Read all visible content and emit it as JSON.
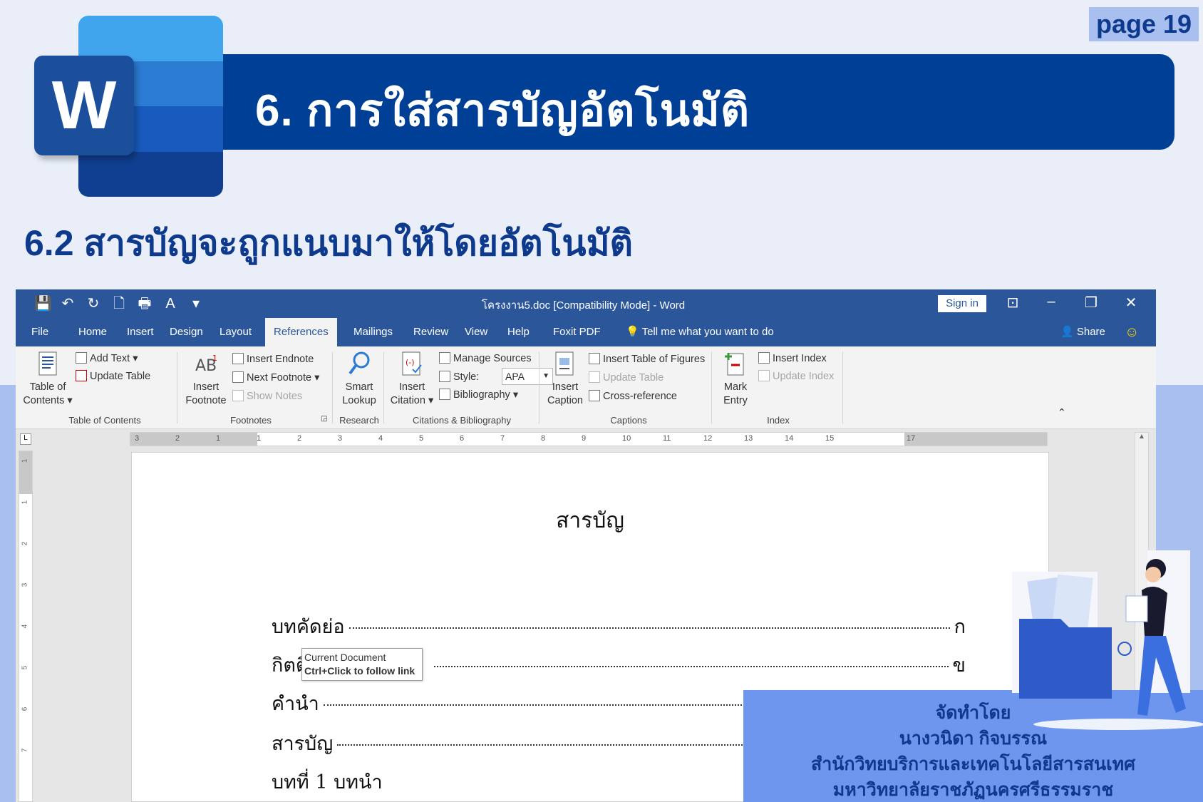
{
  "slide": {
    "page_label": "page 19",
    "title": "6.   การใส่สารบัญอัตโนมัติ",
    "subtitle": "6.2  สารบัญจะถูกแนบมาให้โดยอัตโนมัติ",
    "logo_letter": "W"
  },
  "window": {
    "title": "โครงงาน5.doc [Compatibility Mode]  -  Word",
    "sign_in": "Sign in",
    "share": "Share"
  },
  "tabs": [
    "File",
    "Home",
    "Insert",
    "Design",
    "Layout",
    "References",
    "Mailings",
    "Review",
    "View",
    "Help",
    "Foxit PDF"
  ],
  "active_tab": "References",
  "tell_me": "Tell me what you want to do",
  "ribbon": {
    "toc": {
      "big": [
        "Table of",
        "Contents ▾"
      ],
      "add_text": "Add Text ▾",
      "update_table": "Update Table",
      "label": "Table of Contents"
    },
    "footnotes": {
      "big": [
        "Insert",
        "Footnote"
      ],
      "insert_endnote": "Insert Endnote",
      "next_footnote": "Next Footnote",
      "show_notes": "Show Notes",
      "label": "Footnotes"
    },
    "research": {
      "big": [
        "Smart",
        "Lookup"
      ],
      "label": "Research"
    },
    "citations": {
      "big": [
        "Insert",
        "Citation ▾"
      ],
      "manage_sources": "Manage Sources",
      "style_label": "Style:",
      "style_value": "APA",
      "bibliography": "Bibliography ▾",
      "label": "Citations & Bibliography"
    },
    "captions": {
      "big": [
        "Insert",
        "Caption"
      ],
      "insert_tof": "Insert Table of Figures",
      "update_table": "Update Table",
      "cross_ref": "Cross-reference",
      "label": "Captions"
    },
    "index": {
      "big": [
        "Mark",
        "Entry"
      ],
      "insert_index": "Insert Index",
      "update_index": "Update Index",
      "label": "Index"
    }
  },
  "ruler": {
    "h_labels": [
      "3",
      "2",
      "1",
      "1",
      "2",
      "3",
      "4",
      "5",
      "6",
      "7",
      "8",
      "9",
      "10",
      "11",
      "12",
      "13",
      "14",
      "15",
      "17"
    ],
    "v_labels": [
      "1",
      "1",
      "2",
      "3",
      "4",
      "5",
      "6",
      "7"
    ]
  },
  "document": {
    "heading": "สารบัญ",
    "rows": [
      {
        "label": "บทคัดย่อ",
        "page": "ก"
      },
      {
        "label": "กิตติก",
        "page": "ข"
      },
      {
        "label": "คำนำ",
        "page": ""
      },
      {
        "label": "สารบัญ",
        "page": ""
      },
      {
        "label": "บทที่  1 บทนำ",
        "page": ""
      }
    ],
    "tooltip": {
      "line1": "Current Document",
      "line2": "Ctrl+Click to follow link"
    }
  },
  "credits": {
    "lines": [
      "จัดทำโดย",
      "นางวนิดา กิจบรรณ",
      "สำนักวิทยบริการและเทคโนโลยีสารสนเทศ",
      "มหาวิทยาลัยราชภัฏนครศรีธรรมราช"
    ]
  },
  "colors": {
    "word_blue": "#2b579a",
    "title_blue": "#003f96",
    "badge": "#a9bff0"
  }
}
